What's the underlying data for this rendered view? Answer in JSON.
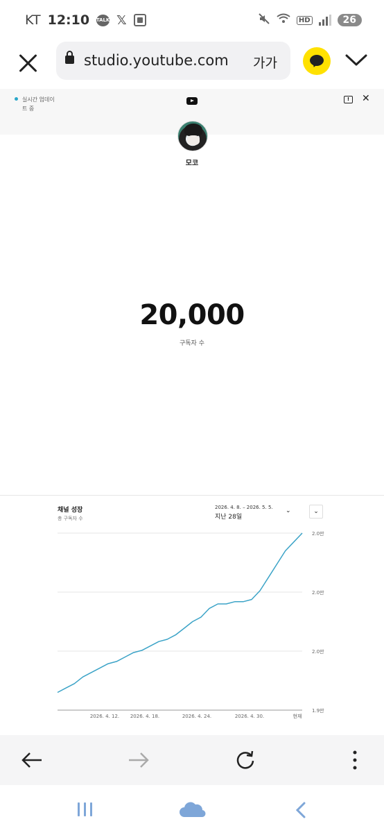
{
  "status_bar": {
    "carrier": "KT",
    "time": "12:10",
    "talk_badge": "TALK",
    "x_app": "𝕏",
    "hd_badge": "HD",
    "battery": "26"
  },
  "browser": {
    "url": "studio.youtube.com",
    "font_size_label": "가가"
  },
  "page": {
    "live_update_text": "실시간 업데이트 중",
    "channel_name": "모코",
    "subscriber_count": "20,000",
    "subscriber_label": "구독자 수"
  },
  "growth_card": {
    "title": "채널 성장",
    "subtitle": "총 구독자 수",
    "date_range": "2026. 4. 8. – 2026. 5. 5.",
    "period_label": "지난 28일"
  },
  "chart_data": {
    "type": "line",
    "title": "채널 성장",
    "ylabel": "",
    "x_tick_labels": [
      "2026. 4. 12.",
      "2026. 4. 18.",
      "2026. 4. 24.",
      "2026. 4. 30.",
      "현재"
    ],
    "y_tick_labels": [
      "2.0만",
      "2.0만",
      "2.0만",
      "1.9만"
    ],
    "ylim": [
      19920,
      20000
    ],
    "grid": true,
    "series": [
      {
        "values": [
          19928,
          19930,
          19932,
          19935,
          19937,
          19939,
          19941,
          19942,
          19944,
          19946,
          19947,
          19949,
          19951,
          19952,
          19954,
          19957,
          19960,
          19962,
          19966,
          19968,
          19968,
          19969,
          19969,
          19970,
          19974,
          19980,
          19986,
          19992,
          19996,
          20000
        ]
      }
    ]
  }
}
